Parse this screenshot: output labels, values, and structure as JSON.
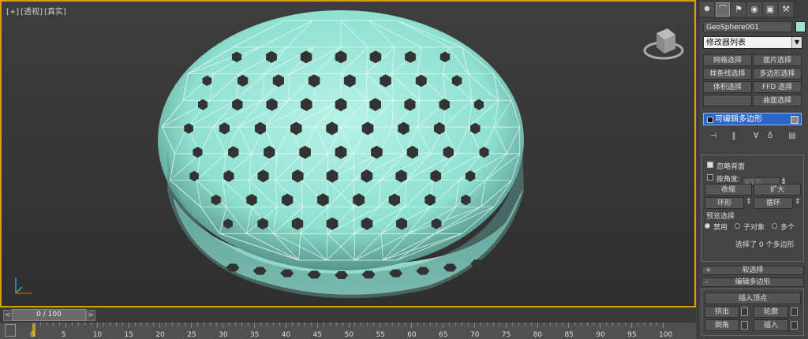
{
  "viewport": {
    "label_plus": "[+]",
    "label_view": "[透视]",
    "label_shading": "[真实]",
    "mesh_color": "#8fe0d0",
    "border_color": "#d4a300"
  },
  "timeline": {
    "slider_text": "0 / 100",
    "prev": "<",
    "next": ">",
    "ticks": [
      "0",
      "5",
      "10",
      "15",
      "20",
      "25",
      "30",
      "35",
      "40",
      "45",
      "50",
      "55",
      "60",
      "65",
      "70",
      "75",
      "80",
      "85",
      "90",
      "95",
      "100"
    ]
  },
  "panel": {
    "tab_icons": [
      "sun-create-icon",
      "modify-arc-icon",
      "hierarchy-icon",
      "motion-icon",
      "display-icon",
      "utilities-hammer-icon"
    ],
    "object_name": "GeoSphere001",
    "object_color": "#9ae6d6",
    "modifier_list": "修改器列表",
    "buttons": {
      "mesh_select": "网格选择",
      "patch_select": "面片选择",
      "spline_select": "样条线选择",
      "poly_select": "多边形选择",
      "vol_select": "体积选择",
      "ffd_select": "FFD 选择",
      "surface_select": "曲面选择"
    },
    "stack_item": "可编辑多边形",
    "ignore_backfacing": "忽略背面",
    "by_angle": "按角度:",
    "angle_value": "45.0",
    "shrink": "收缩",
    "grow": "扩大",
    "ring": "环形",
    "loop": "循环",
    "preview_selection": "预览选择",
    "disabled": "禁用",
    "subobject": "子对象",
    "multi": "多个",
    "status": "选择了 0 个多边形",
    "soft_selection": "软选择",
    "edit_polygons": "编辑多边形",
    "insert_vertex": "插入顶点",
    "extrude": "挤出",
    "outline": "轮廓",
    "bevel": "倒角",
    "inset": "插入"
  }
}
